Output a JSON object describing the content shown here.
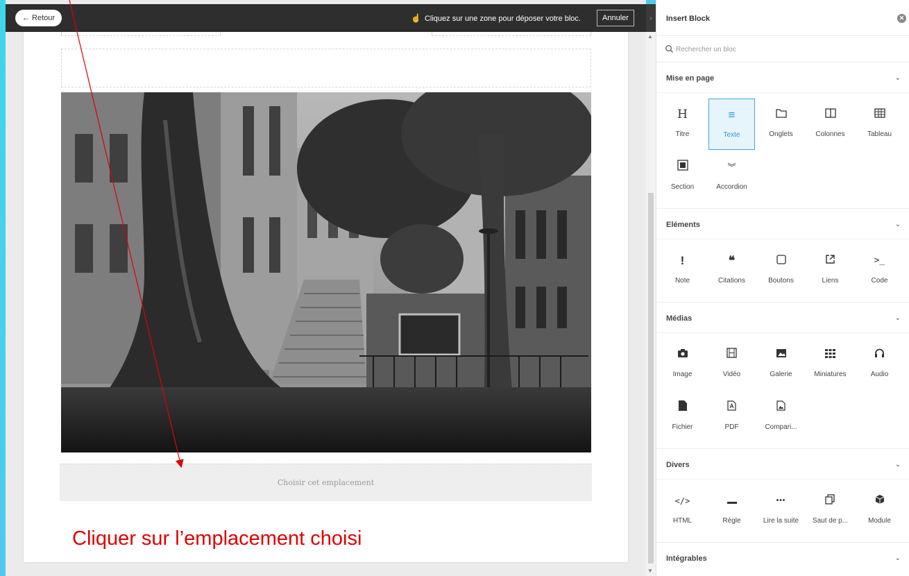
{
  "topbar": {
    "back_label": "← Retour",
    "hint_text": "Cliquez sur une zone pour déposer votre bloc.",
    "cancel_label": "Annuler"
  },
  "canvas": {
    "drop_zone_label": "Choisir cet emplacement",
    "annotation_text": "Cliquer sur l’emplacement choisi",
    "annotation_color": "#e00000"
  },
  "panel": {
    "title": "Insert Block",
    "search_placeholder": "Rechercher un bloc",
    "accent_color": "#2a9bd6",
    "sections": [
      {
        "title": "Mise en page",
        "items": [
          {
            "label": "Titre",
            "icon": "H"
          },
          {
            "label": "Texte",
            "icon": "≡",
            "active": true
          },
          {
            "label": "Onglets",
            "icon": "folder-icon"
          },
          {
            "label": "Colonnes",
            "icon": "columns-icon"
          },
          {
            "label": "Tableau",
            "icon": "table-icon"
          },
          {
            "label": "Section",
            "icon": "section-icon"
          },
          {
            "label": "Accordion",
            "icon": "double-chevron-icon"
          }
        ]
      },
      {
        "title": "Eléments",
        "items": [
          {
            "label": "Note",
            "icon": "!"
          },
          {
            "label": "Citations",
            "icon": "❝"
          },
          {
            "label": "Boutons",
            "icon": "square-icon"
          },
          {
            "label": "Liens",
            "icon": "external-link-icon"
          },
          {
            "label": "Code",
            "icon": ">_"
          }
        ]
      },
      {
        "title": "Médias",
        "items": [
          {
            "label": "Image",
            "icon": "camera-icon"
          },
          {
            "label": "Vidéo",
            "icon": "film-icon"
          },
          {
            "label": "Galerie",
            "icon": "picture-icon"
          },
          {
            "label": "Miniatures",
            "icon": "grid-icon"
          },
          {
            "label": "Audio",
            "icon": "headphones-icon"
          },
          {
            "label": "Fichier",
            "icon": "file-icon"
          },
          {
            "label": "PDF",
            "icon": "pdf-icon"
          },
          {
            "label": "Compari...",
            "icon": "compare-icon"
          }
        ]
      },
      {
        "title": "Divers",
        "items": [
          {
            "label": "HTML",
            "icon": "</>"
          },
          {
            "label": "Règle",
            "icon": "rule-icon"
          },
          {
            "label": "Lire la suite",
            "icon": "•••"
          },
          {
            "label": "Saut de p...",
            "icon": "copy-icon"
          },
          {
            "label": "Module",
            "icon": "cube-icon"
          }
        ]
      },
      {
        "title": "Intégrables",
        "items": []
      }
    ]
  }
}
